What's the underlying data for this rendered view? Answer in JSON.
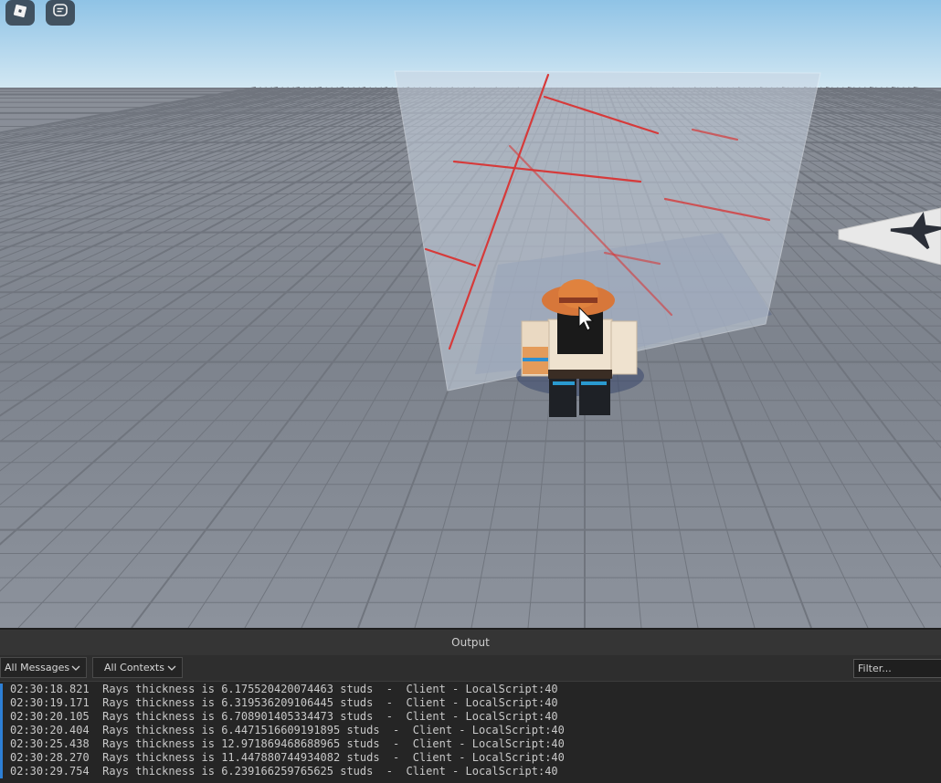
{
  "topbar": {
    "menu_icon": "roblox-logo-icon",
    "chat_icon": "chat-bubble-icon"
  },
  "viewport": {
    "sky_color": "#b8d9ee",
    "ground_color": "#8a8f98",
    "ray_color": "#d63a3a"
  },
  "output": {
    "title": "Output",
    "messages_filter": "All Messages",
    "contexts_filter": "All Contexts",
    "filter_placeholder": "Filter...",
    "accent_color": "#2d7fd6",
    "lines": [
      "02:30:18.821  Rays thickness is 6.175520420074463 studs  -  Client - LocalScript:40",
      "02:30:19.171  Rays thickness is 6.319536209106445 studs  -  Client - LocalScript:40",
      "02:30:20.105  Rays thickness is 6.708901405334473 studs  -  Client - LocalScript:40",
      "02:30:20.404  Rays thickness is 6.4471516609191895 studs  -  Client - LocalScript:40",
      "02:30:25.438  Rays thickness is 12.971869468688965 studs  -  Client - LocalScript:40",
      "02:30:28.270  Rays thickness is 11.447880744934082 studs  -  Client - LocalScript:40",
      "02:30:29.754  Rays thickness is 6.239166259765625 studs  -  Client - LocalScript:40"
    ]
  }
}
